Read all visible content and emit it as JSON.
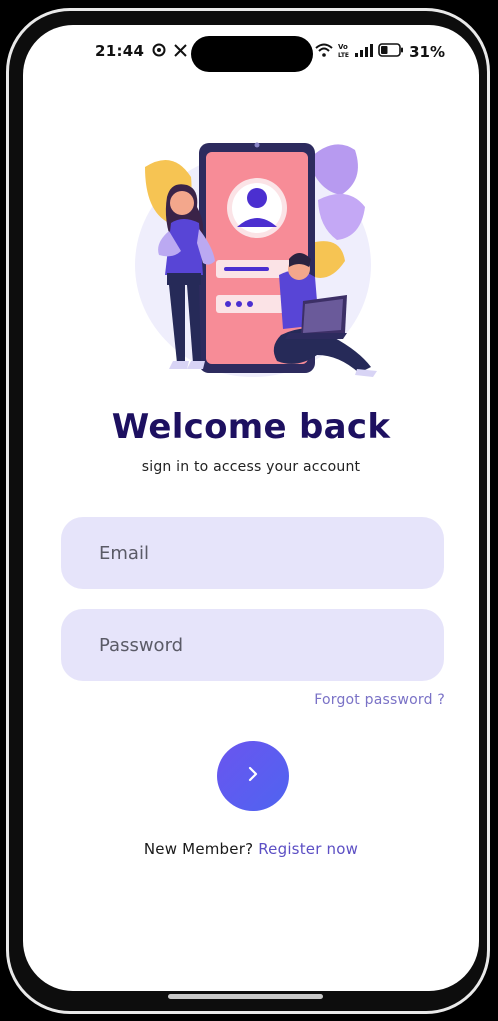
{
  "status_bar": {
    "time": "21:44",
    "battery_percent": "31%",
    "network_label": "Vo LTE"
  },
  "welcome": {
    "title": "Welcome back",
    "subtitle": "sign in to access your account"
  },
  "form": {
    "email_placeholder": "Email",
    "password_placeholder": "Password",
    "forgot_label": "Forgot password ?",
    "submit_icon": "chevron-right-icon"
  },
  "footer": {
    "new_member_label": "New Member?",
    "register_label": "Register now"
  },
  "colors": {
    "title": "#1d1060",
    "input_bg": "#e6e4fa",
    "accent": "#6a55ef",
    "link": "#5c4fc4"
  }
}
